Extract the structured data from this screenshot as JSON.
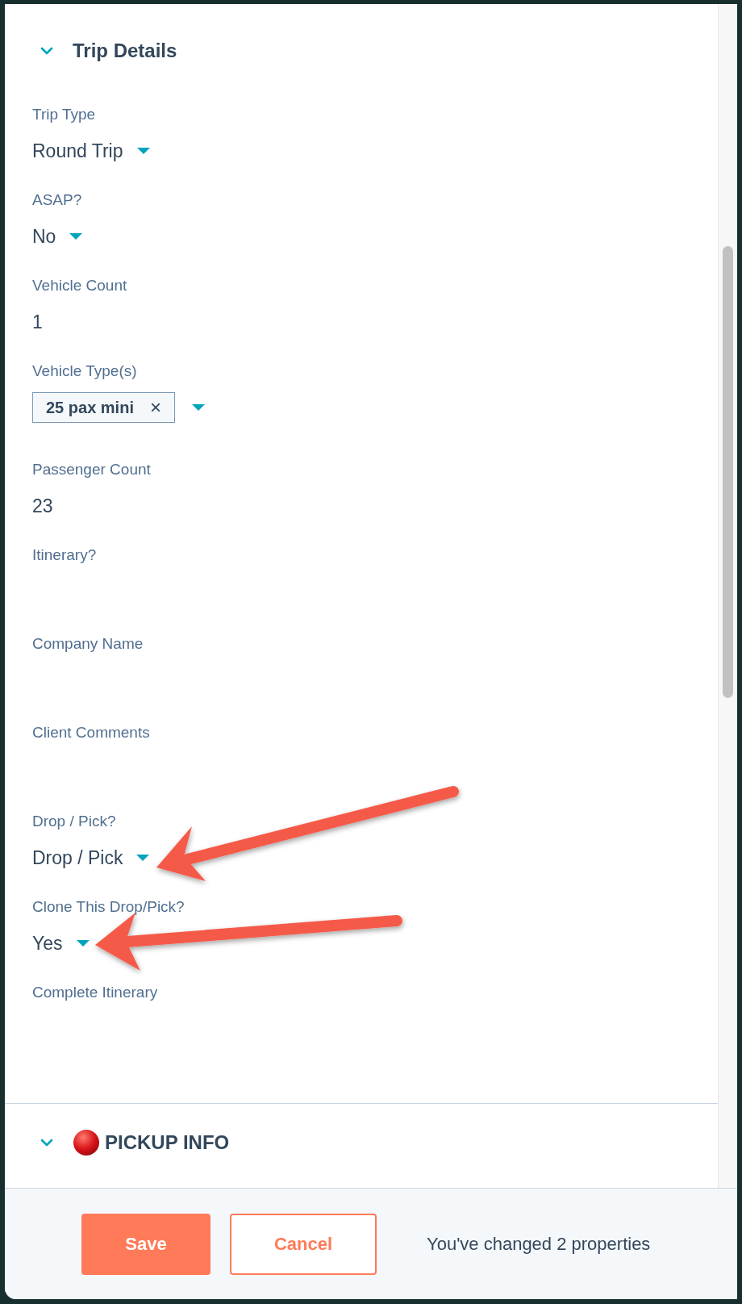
{
  "sections": [
    {
      "title": "Trip Details",
      "expanded": true,
      "kind": "plain",
      "fields": [
        {
          "label": "Trip Type",
          "kind": "dropdown",
          "value": "Round Trip",
          "annotated": false
        },
        {
          "label": "ASAP?",
          "kind": "dropdown",
          "value": "No",
          "annotated": false
        },
        {
          "label": "Vehicle Count",
          "kind": "text",
          "value": "1",
          "annotated": false
        },
        {
          "label": "Vehicle Type(s)",
          "kind": "tags",
          "tags": [
            {
              "text": "25 pax mini",
              "remove": "×"
            }
          ],
          "annotated": false
        },
        {
          "label": "Passenger Count",
          "kind": "text",
          "value": "23",
          "annotated": false
        },
        {
          "label": "Itinerary?",
          "kind": "empty",
          "annotated": false
        },
        {
          "label": "Company Name",
          "kind": "empty",
          "annotated": false
        },
        {
          "label": "Client Comments",
          "kind": "empty",
          "annotated": false
        },
        {
          "label": "Drop / Pick?",
          "kind": "dropdown",
          "value": "Drop / Pick",
          "annotated": true
        },
        {
          "label": "Clone This Drop/Pick?",
          "kind": "dropdown",
          "value": "Yes",
          "annotated": true
        },
        {
          "label": "Complete Itinerary",
          "kind": "empty",
          "annotated": false
        }
      ]
    },
    {
      "title": "PICKUP INFO",
      "expanded": true,
      "kind": "dot"
    }
  ],
  "footer": {
    "buttons": [
      {
        "label": "Save",
        "kind": "primary"
      },
      {
        "label": "Cancel",
        "kind": "secondary"
      }
    ],
    "message": "You've changed 2 properties"
  }
}
